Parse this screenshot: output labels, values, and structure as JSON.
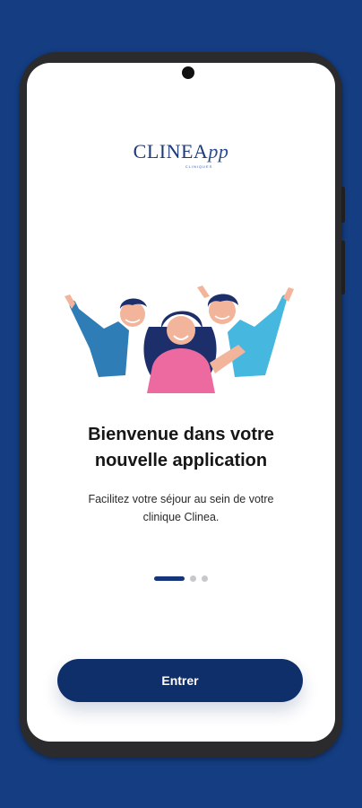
{
  "app": {
    "logo_main": "CLINEA",
    "logo_app": "pp",
    "logo_subtitle": "CLINIQUES"
  },
  "onboarding": {
    "title_line1": "Bienvenue dans votre",
    "title_line2": "nouvelle application",
    "description_line1": "Facilitez votre séjour au sein de votre",
    "description_line2": "clinique Clinea.",
    "page_indicator": {
      "current": 1,
      "total": 3
    },
    "cta_label": "Entrer"
  },
  "colors": {
    "background": "#143d82",
    "primary": "#0f2f6b",
    "text": "#161616"
  },
  "illustration": {
    "icon": "happy-group-illustration"
  }
}
